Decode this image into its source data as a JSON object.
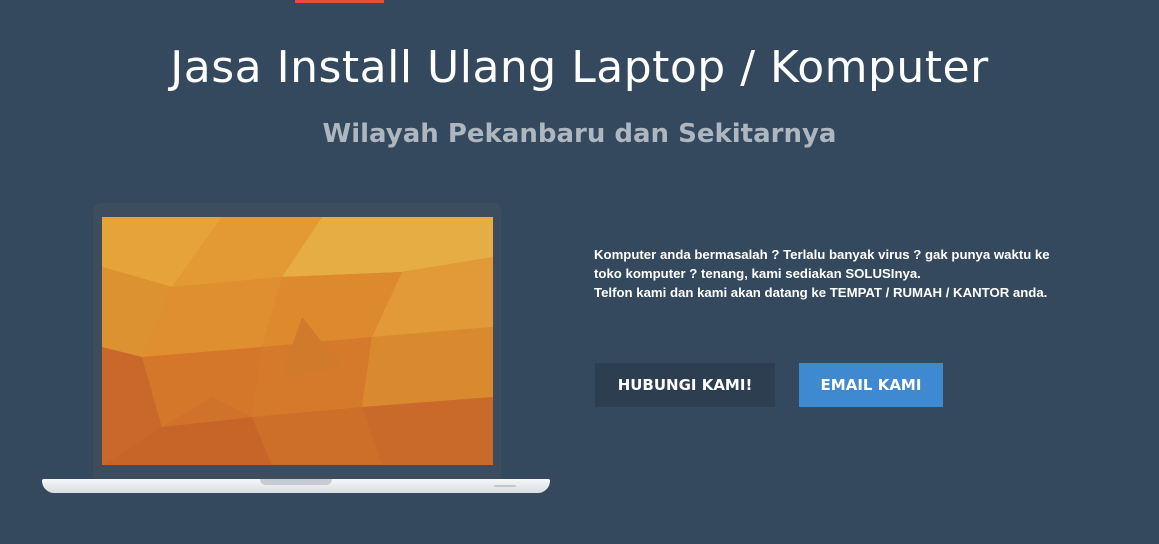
{
  "header": {
    "title": "Jasa Install Ulang Laptop / Komputer",
    "subtitle": "Wilayah Pekanbaru dan Sekitarnya"
  },
  "description": {
    "line1": "Komputer anda bermasalah ? Terlalu banyak virus ? gak punya waktu ke",
    "line2_prefix": "toko komputer ? tenang, kami sediakan ",
    "line2_bold": "SOLUSI",
    "line2_suffix": "nya.",
    "line3": "Telfon kami dan kami akan datang ke TEMPAT / RUMAH / KANTOR anda."
  },
  "buttons": {
    "contact_label": "HUBUNGI KAMI!",
    "email_label": "EMAIL KAMI"
  },
  "colors": {
    "background": "#34495e",
    "accent": "#e74c3c",
    "contact_button": "#2c3e50",
    "email_button": "#3f89d0",
    "screen_wallpaper": "#e08a2c"
  },
  "icons": {
    "laptop": "laptop-illustration"
  }
}
